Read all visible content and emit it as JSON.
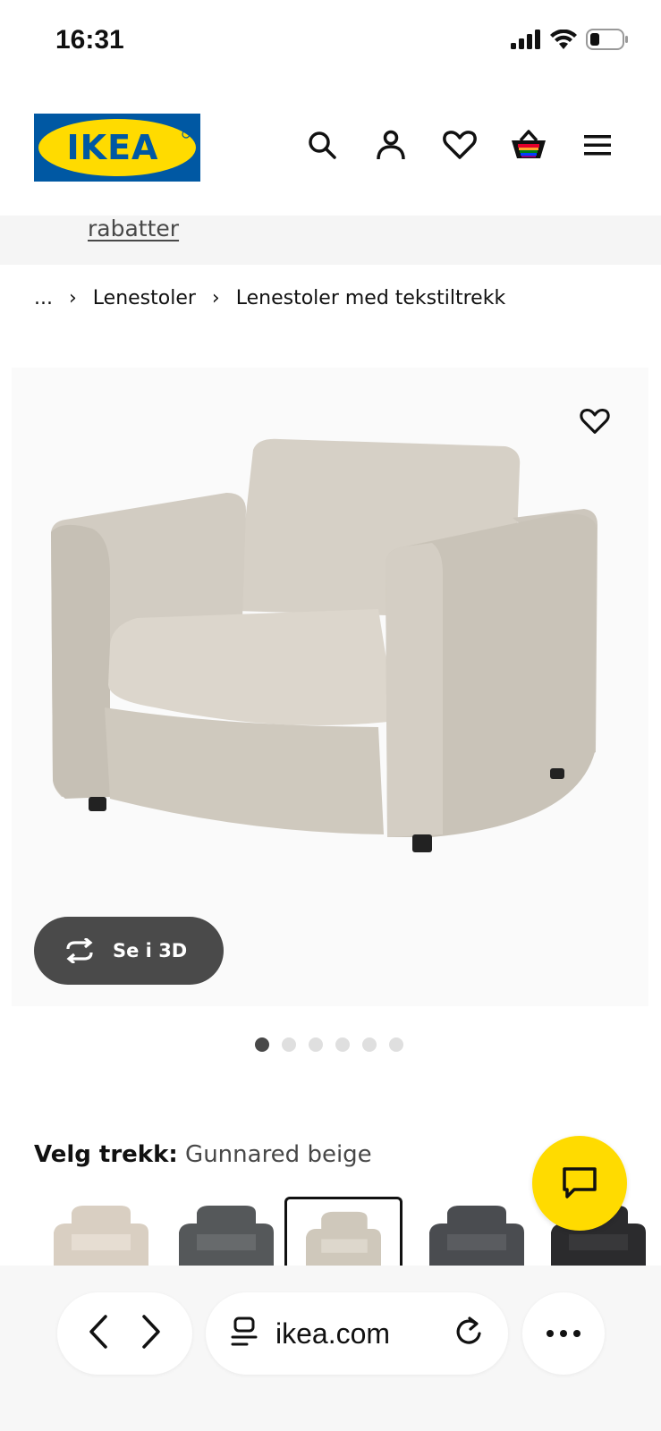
{
  "status_bar": {
    "time": "16:31",
    "icons": [
      "signal-icon",
      "wifi-icon",
      "battery-icon"
    ]
  },
  "header": {
    "logo_text": "IKEA",
    "icons": [
      "search-icon",
      "account-icon",
      "heart-icon",
      "basket-icon",
      "menu-icon"
    ]
  },
  "promo": {
    "link_text": "rabatter"
  },
  "breadcrumb": {
    "ellipsis": "...",
    "items": [
      "Lenestoler",
      "Lenestoler med tekstiltrekk"
    ]
  },
  "product": {
    "view3d_label": "Se i 3D",
    "image_count": 6,
    "active_image": 1
  },
  "variant": {
    "label": "Velg trekk:",
    "value": "Gunnared beige",
    "swatches": [
      {
        "color": "#d9cfc2"
      },
      {
        "color": "#55585a"
      },
      {
        "color": "#cfc8bb",
        "selected": true
      },
      {
        "color": "#4a4c50"
      },
      {
        "color": "#2b2b2d"
      }
    ]
  },
  "browser": {
    "url": "ikea.com"
  },
  "colors": {
    "ikea_blue": "#0058a3",
    "ikea_yellow": "#ffdb00",
    "dark_button": "#4a4a4a"
  }
}
